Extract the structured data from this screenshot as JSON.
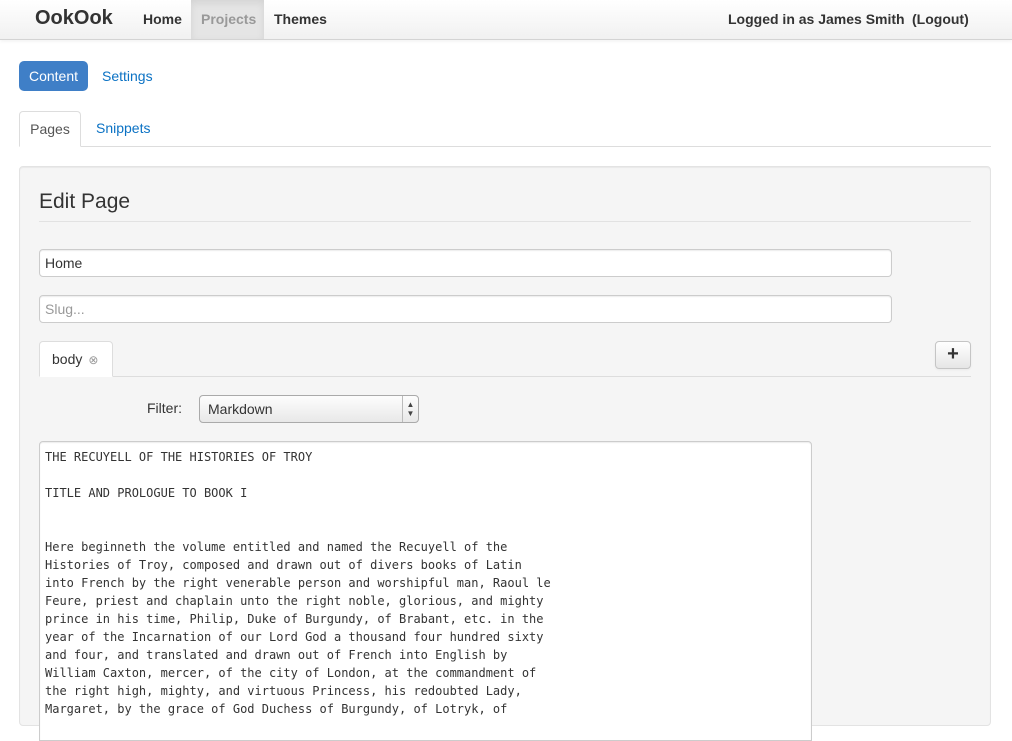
{
  "navbar": {
    "brand": "OokOok",
    "items": [
      {
        "label": "Home",
        "active": false
      },
      {
        "label": "Projects",
        "active": true
      },
      {
        "label": "Themes",
        "active": false
      }
    ],
    "user": "Logged in as James Smith",
    "logout": "(Logout)"
  },
  "pills": [
    {
      "label": "Content",
      "active": true
    },
    {
      "label": "Settings",
      "active": false
    }
  ],
  "tabs": [
    {
      "label": "Pages",
      "active": true
    },
    {
      "label": "Snippets",
      "active": false
    }
  ],
  "edit": {
    "heading": "Edit Page",
    "title_value": "Home",
    "slug_placeholder": "Slug...",
    "part_tab": "body",
    "part_close": "⊗",
    "add_part": "+",
    "filter_label": "Filter:",
    "filter_value": "Markdown",
    "filter_arrows": "▲▼",
    "body_lines": [
      "THE RECUYELL OF THE HISTORIES OF TROY",
      "",
      "TITLE AND PROLOGUE TO BOOK I",
      "",
      "",
      "Here beginneth the volume entitled and named the Recuyell of the",
      "Histories of Troy, composed and drawn out of divers books of Latin",
      "into French by the right venerable person and worshipful man, Raoul le",
      "Feure, priest and chaplain unto the right noble, glorious, and mighty",
      "prince in his time, Philip, Duke of Burgundy, of Brabant, etc. in the",
      "year of the Incarnation of our Lord God a thousand four hundred sixty",
      "and four, and translated and drawn out of French into English by",
      "William Caxton, mercer, of the city of London, at the commandment of",
      "the right high, mighty, and virtuous Princess, his redoubted Lady,",
      "Margaret, by the grace of God Duchess of Burgundy, of Lotryk, of"
    ]
  },
  "colors": {
    "primary": "#3f7fc7",
    "link": "#0b72c4"
  }
}
